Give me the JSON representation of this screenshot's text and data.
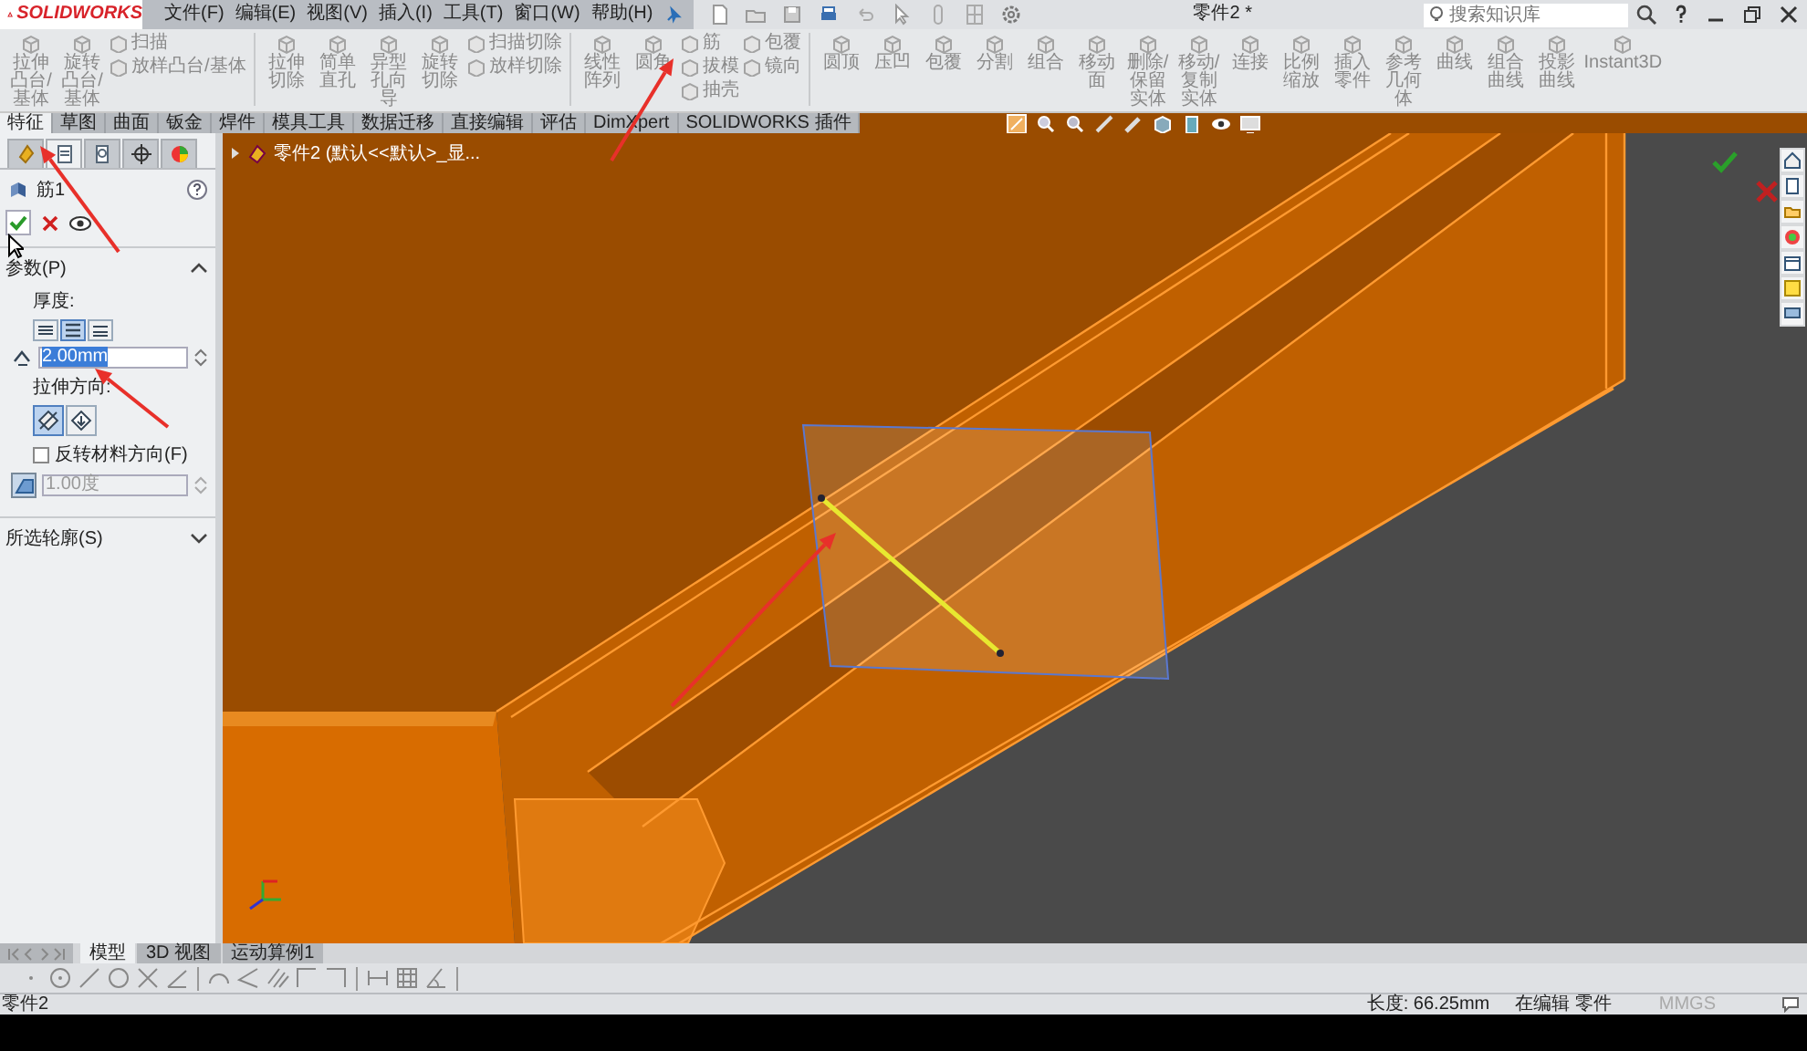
{
  "app": {
    "logo": "SOLIDWORKS",
    "menus": [
      "文件(F)",
      "编辑(E)",
      "视图(V)",
      "插入(I)",
      "工具(T)",
      "窗口(W)",
      "帮助(H)"
    ],
    "title": "零件2 *",
    "search": {
      "placeholder": "搜索知识库"
    }
  },
  "ribbon": {
    "columns": [
      {
        "kind": "large",
        "label": "拉伸凸台/基体"
      },
      {
        "kind": "large",
        "label": "旋转凸台/基体"
      },
      {
        "kind": "stack",
        "items": [
          "扫描",
          "放样凸台/基体"
        ]
      },
      {
        "kind": "separator"
      },
      {
        "kind": "large",
        "label": "拉伸切除"
      },
      {
        "kind": "large",
        "label": "简单直孔"
      },
      {
        "kind": "large",
        "label": "异型孔向导"
      },
      {
        "kind": "large",
        "label": "旋转切除"
      },
      {
        "kind": "stack",
        "items": [
          "扫描切除",
          "放样切除"
        ]
      },
      {
        "kind": "separator"
      },
      {
        "kind": "large",
        "label": "线性阵列"
      },
      {
        "kind": "large",
        "label": "圆角"
      },
      {
        "kind": "stack",
        "items": [
          "筋",
          "拔模",
          "抽壳"
        ]
      },
      {
        "kind": "stack",
        "items": [
          "包覆",
          "镜向"
        ]
      },
      {
        "kind": "separator"
      },
      {
        "kind": "large",
        "label": "圆顶"
      },
      {
        "kind": "large",
        "label": "压凹"
      },
      {
        "kind": "large",
        "label": "包覆"
      },
      {
        "kind": "large",
        "label": "分割"
      },
      {
        "kind": "large",
        "label": "组合"
      },
      {
        "kind": "large",
        "label": "移动面"
      },
      {
        "kind": "large",
        "label": "删除/保留实体"
      },
      {
        "kind": "large",
        "label": "移动/复制实体"
      },
      {
        "kind": "large",
        "label": "连接"
      },
      {
        "kind": "large",
        "label": "比例缩放"
      },
      {
        "kind": "large",
        "label": "插入零件"
      },
      {
        "kind": "large",
        "label": "参考几何体"
      },
      {
        "kind": "large",
        "label": "曲线"
      },
      {
        "kind": "large",
        "label": "组合曲线"
      },
      {
        "kind": "large",
        "label": "投影曲线"
      },
      {
        "kind": "large",
        "label": "Instant3D"
      }
    ]
  },
  "tabs": [
    {
      "label": "特征",
      "selected": true
    },
    {
      "label": "草图",
      "selected": false
    },
    {
      "label": "曲面",
      "selected": false
    },
    {
      "label": "钣金",
      "selected": false
    },
    {
      "label": "焊件",
      "selected": false
    },
    {
      "label": "模具工具",
      "selected": false
    },
    {
      "label": "数据迁移",
      "selected": false
    },
    {
      "label": "直接编辑",
      "selected": false
    },
    {
      "label": "评估",
      "selected": false
    },
    {
      "label": "DimXpert",
      "selected": false
    },
    {
      "label": "SOLIDWORKS 插件",
      "selected": false
    }
  ],
  "property_manager": {
    "panel_tabs": [
      {
        "selected": false
      },
      {
        "selected": true
      },
      {
        "selected": false
      },
      {
        "selected": false
      },
      {
        "selected": false
      }
    ],
    "title": "筋1",
    "parameters": {
      "label": "参数(P)",
      "expanded": true,
      "thickness_label": "厚度:",
      "thickness_options": [
        {
          "selected": false
        },
        {
          "selected": true
        },
        {
          "selected": false
        }
      ],
      "thickness": "2.00mm",
      "direction_label": "拉伸方向:",
      "direction_options": [
        {
          "selected": true
        },
        {
          "selected": false
        }
      ],
      "flip": {
        "label": "反转材料方向(F)",
        "checked": false
      },
      "draft": {
        "value": "1.00度",
        "disabled": true
      }
    },
    "contours": {
      "label": "所选轮廓(S)",
      "expanded": false
    }
  },
  "viewport": {
    "tree_flyout": "零件2 (默认<<默认>_显..."
  },
  "bottom_tabs": [
    {
      "label": "模型",
      "selected": true
    },
    {
      "label": "3D 视图",
      "selected": false
    },
    {
      "label": "运动算例1",
      "selected": false
    }
  ],
  "status_bar": {
    "document": "零件2",
    "length": "长度: 66.25mm",
    "mode": "在编辑 零件",
    "units": "MMGS"
  }
}
